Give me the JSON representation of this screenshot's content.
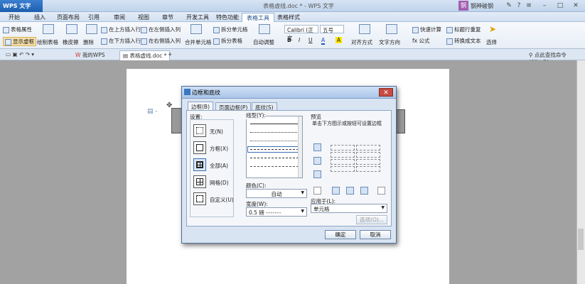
{
  "titlebar": {
    "app_label": "WPS 文字",
    "doc_title": "表格虚线.doc * - WPS 文字",
    "user_badge": "钢",
    "user_name": "钢神碰钢"
  },
  "menu": [
    "开始",
    "插入",
    "页面布局",
    "引用",
    "审阅",
    "视图",
    "章节",
    "开发工具",
    "特色功能",
    "表格工具",
    "表格样式"
  ],
  "menu_active_index": 9,
  "ribbon": {
    "table_props": "表格属性",
    "show_gridlines": "显示虚框",
    "draw_table": "绘制表格",
    "eraser": "橡皮擦",
    "delete": "删除",
    "insert_above": "在上方插入行",
    "insert_below": "在下方插入行",
    "insert_left": "在左侧插入列",
    "insert_right": "在右侧插入列",
    "merge_cells": "合并单元格",
    "split_cells": "拆分单元格",
    "split_table": "拆分表格",
    "autofit": "自动调整",
    "font_name": "Calibri (正文",
    "font_size": "五号",
    "align": "对齐方式",
    "text_direction": "文字方向",
    "formula": "fx 公式",
    "quick_calc": "快速计算",
    "repeat_header": "标题行重复",
    "convert_text": "转换成文本",
    "select": "选择"
  },
  "tabs": {
    "my_wps": "我的WPS",
    "doc_tab": "表格虚线.doc *",
    "search_hint": "点此查找命令 (Alt+Q)"
  },
  "dialog": {
    "title": "边框和底纹",
    "tabs": [
      "边框(B)",
      "页面边框(P)",
      "底纹(S)"
    ],
    "settings_label": "设置:",
    "settings": [
      "无(N)",
      "方框(X)",
      "全部(A)",
      "网格(D)",
      "自定义(U)"
    ],
    "style_label": "线型(Y):",
    "color_label": "颜色(C):",
    "color_value": "自动",
    "width_label": "宽度(W):",
    "width_value": "0.5 磅",
    "preview_label": "预览",
    "preview_hint": "单击下方图示或按钮可设置边框",
    "apply_label": "应用于(L):",
    "apply_value": "单元格",
    "options_button": "选项(O)...",
    "ok": "确定",
    "cancel": "取消"
  }
}
